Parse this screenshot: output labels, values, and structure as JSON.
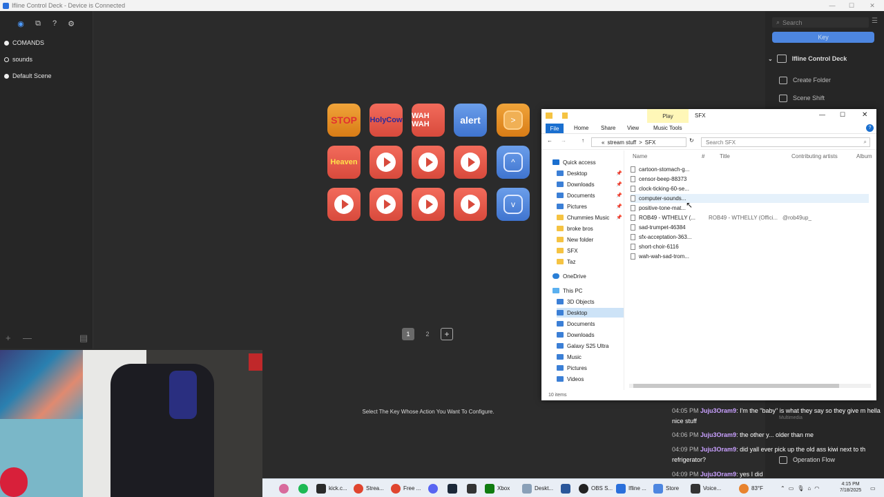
{
  "window": {
    "title": "Ifline Control Deck - Device is Connected",
    "minimize": "—",
    "maximize": "☐",
    "close": "✕"
  },
  "sidebar": {
    "tools": [
      "◉",
      "⧉",
      "?",
      "⚙"
    ],
    "scenes": [
      {
        "label": "COMANDS",
        "active": true
      },
      {
        "label": "sounds",
        "active": false
      },
      {
        "label": "Default Scene",
        "active": true
      }
    ],
    "add": "+",
    "remove": "—",
    "folder": "▤"
  },
  "keys": [
    {
      "kind": "text",
      "label": "STOP",
      "color": "orange",
      "textColor": "#e23030"
    },
    {
      "kind": "text",
      "label": "HolyCow",
      "color": "red",
      "textColor": "#2a2a9a"
    },
    {
      "kind": "text",
      "label": "WAH WAH",
      "color": "red",
      "textColor": "#ffffff"
    },
    {
      "kind": "text",
      "label": "alert",
      "color": "blue",
      "textColor": "#ffffff"
    },
    {
      "kind": "arrow",
      "label": ">",
      "color": "orange"
    },
    {
      "kind": "text",
      "label": "Heaven",
      "color": "red",
      "textColor": "#ffe14a"
    },
    {
      "kind": "play",
      "color": "red"
    },
    {
      "kind": "play",
      "color": "red"
    },
    {
      "kind": "play",
      "color": "red"
    },
    {
      "kind": "nav",
      "label": "^",
      "color": "blue"
    },
    {
      "kind": "play",
      "color": "red"
    },
    {
      "kind": "play",
      "color": "red"
    },
    {
      "kind": "play",
      "color": "red"
    },
    {
      "kind": "play",
      "color": "red"
    },
    {
      "kind": "nav",
      "label": "v",
      "color": "blue"
    }
  ],
  "pager": {
    "pages": [
      "1",
      "2"
    ],
    "add": "+"
  },
  "hint": "Select The Key Whose Action You Want To Configure.",
  "right_panel": {
    "search_placeholder": "Search",
    "tab": "Key",
    "device": "Ifline Control Deck",
    "items": [
      "Create Folder",
      "Scene Shift"
    ],
    "operation": "Operation Flow",
    "multimedia": "Multimedia"
  },
  "explorer": {
    "play_tab": "Play",
    "folder_name": "SFX",
    "ribbon": [
      "File",
      "Home",
      "Share",
      "View",
      "Music Tools"
    ],
    "address": [
      "«",
      "stream stuff",
      ">",
      "SFX"
    ],
    "search_placeholder": "Search SFX",
    "columns": [
      "Name",
      "#",
      "Title",
      "Contributing artists",
      "Album"
    ],
    "nav": {
      "quick_access": "Quick access",
      "items": [
        {
          "label": "Desktop",
          "pinned": true,
          "icon": "blue"
        },
        {
          "label": "Downloads",
          "pinned": true,
          "icon": "blue"
        },
        {
          "label": "Documents",
          "pinned": true,
          "icon": "blue"
        },
        {
          "label": "Pictures",
          "pinned": true,
          "icon": "blue"
        },
        {
          "label": "Chummies Music",
          "pinned": true,
          "icon": "folder"
        },
        {
          "label": "broke bros",
          "pinned": false,
          "icon": "folder"
        },
        {
          "label": "New folder",
          "pinned": false,
          "icon": "folder"
        },
        {
          "label": "SFX",
          "pinned": false,
          "icon": "folder"
        },
        {
          "label": "Taz",
          "pinned": false,
          "icon": "folder"
        }
      ],
      "onedrive": "OneDrive",
      "this_pc": "This PC",
      "pc_items": [
        "3D Objects",
        "Desktop",
        "Documents",
        "Downloads",
        "Galaxy S25 Ultra",
        "Music",
        "Pictures",
        "Videos"
      ]
    },
    "files": [
      {
        "name": "cartoon-stomach-g...",
        "title": "",
        "artist": ""
      },
      {
        "name": "censor-beep-88373",
        "title": "",
        "artist": ""
      },
      {
        "name": "clock-ticking-60-se...",
        "title": "",
        "artist": ""
      },
      {
        "name": "computer-sounds...",
        "title": "",
        "artist": ""
      },
      {
        "name": "positive-tone-mat...",
        "title": "",
        "artist": ""
      },
      {
        "name": "ROB49 - WTHELLY (...",
        "title": "ROB49 - WTHELLY (Offici...",
        "artist": "@rob49up_"
      },
      {
        "name": "sad-trumpet-46384",
        "title": "",
        "artist": ""
      },
      {
        "name": "sfx-acceptation-363...",
        "title": "",
        "artist": ""
      },
      {
        "name": "short-choir-6116",
        "title": "",
        "artist": ""
      },
      {
        "name": "wah-wah-sad-trom...",
        "title": "",
        "artist": ""
      }
    ],
    "status": "10 items"
  },
  "chat": [
    {
      "time": "04:05 PM",
      "user": "Juju3Oram9",
      "text": ": I'm the \"baby\" is what they say so they give m hella nice stuff"
    },
    {
      "time": "04:06 PM",
      "user": "Juju3Oram9",
      "text": ": the other y... older than me"
    },
    {
      "time": "04:09 PM",
      "user": "Juju3Oram9",
      "text": ": did yall ever pick up the old ass kiwi next to th refrigerator?"
    },
    {
      "time": "04:09 PM",
      "user": "Juju3Oram9",
      "text": ": yes I did"
    }
  ],
  "taskbar": {
    "items": [
      "kick.c...",
      "Strea...",
      "Free ...",
      "Xbox",
      "Deskt...",
      "OBS S...",
      "Ifline ...",
      "Store",
      "Voice..."
    ],
    "time": "4:15 PM",
    "date": "7/18/2025",
    "temp": "83°F"
  }
}
